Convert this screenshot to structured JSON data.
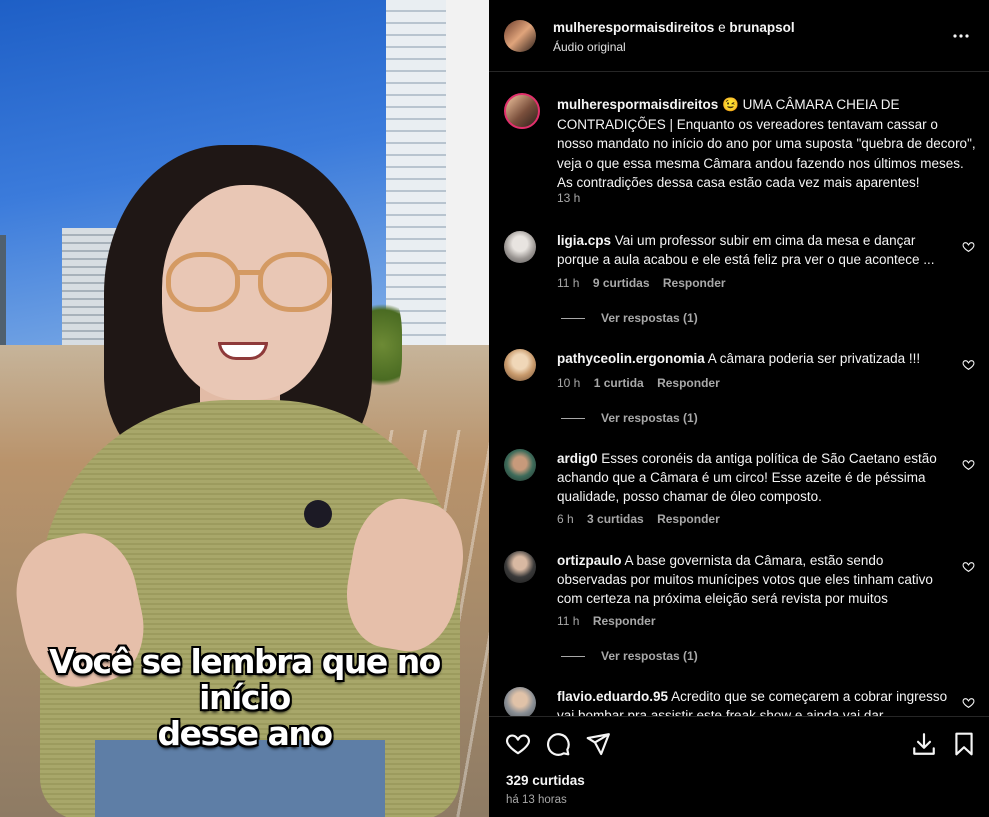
{
  "video": {
    "caption_line1": "Você se lembra que no início",
    "caption_line2": "desse ano"
  },
  "header": {
    "user1": "mulherespormaisdireitos",
    "connector": "e",
    "user2": "brunapsol",
    "audio": "Áudio original",
    "more_icon": "more-horizontal-icon"
  },
  "post": {
    "username": "mulherespormaisdireitos",
    "emoji": "😉",
    "text": "UMA CÂMARA CHEIA DE CONTRADIÇÕES | Enquanto os vereadores tentavam cassar o nosso mandato no início do ano por uma suposta \"quebra de decoro\", veja o que essa mesma Câmara andou fazendo nos últimos meses. As contradições dessa casa estão cada vez mais aparentes!",
    "time": "13 h"
  },
  "comments": [
    {
      "username": "ligia.cps",
      "text": "Vai um professor subir em cima da mesa e dançar porque a aula acabou e ele está feliz pra ver o que acontece ...",
      "time": "11 h",
      "likes": "9 curtidas",
      "reply": "Responder",
      "view_replies": "Ver respostas (1)"
    },
    {
      "username": "pathyceolin.ergonomia",
      "text": "A câmara poderia ser privatizada !!!",
      "time": "10 h",
      "likes": "1 curtida",
      "reply": "Responder",
      "view_replies": "Ver respostas (1)"
    },
    {
      "username": "ardig0",
      "text": "Esses coronéis da antiga política de São Caetano estão achando que a Câmara é um circo! Esse azeite é de péssima qualidade, posso chamar de óleo composto.",
      "time": "6 h",
      "likes": "3 curtidas",
      "reply": "Responder"
    },
    {
      "username": "ortizpaulo",
      "text": "A base governista da Câmara, estão sendo observadas por muitos munícipes votos que eles tinham cativo com certeza na próxima eleição será revista por muitos",
      "time": "11 h",
      "reply": "Responder",
      "view_replies": "Ver respostas (1)"
    },
    {
      "username": "flavio.eduardo.95",
      "text": "Acredito que se começarem a cobrar ingresso vai bombar pra assistir este freak show e ainda vai dar"
    }
  ],
  "footer": {
    "likes": "329 curtidas",
    "ago": "há 13 horas",
    "icons": [
      "heart-icon",
      "comment-icon",
      "share-icon",
      "download-icon",
      "bookmark-icon"
    ]
  },
  "colors": {
    "background": "#000000",
    "text": "#f5f5f5",
    "secondary": "#a8a8a8",
    "divider": "#262626",
    "story_ring": "#e1306c"
  }
}
